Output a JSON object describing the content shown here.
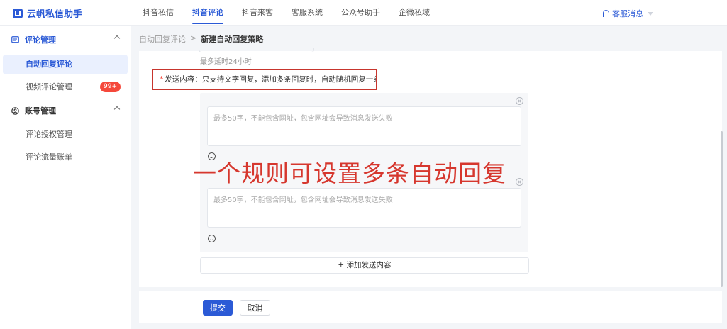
{
  "app": {
    "logo_text": "云帆私信助手"
  },
  "topnav": {
    "items": [
      {
        "label": "抖音私信"
      },
      {
        "label": "抖音评论"
      },
      {
        "label": "抖音来客"
      },
      {
        "label": "客服系统"
      },
      {
        "label": "公众号助手"
      },
      {
        "label": "企微私域"
      }
    ],
    "active_index": 1,
    "notice_label": "客服消息"
  },
  "sidebar": {
    "group1": {
      "label": "评论管理"
    },
    "item_auto_reply": {
      "label": "自动回复评论"
    },
    "item_video_comments": {
      "label": "视频评论管理",
      "badge": "99+"
    },
    "group2": {
      "label": "账号管理"
    },
    "item_auth": {
      "label": "评论授权管理"
    },
    "item_flow": {
      "label": "评论流量账单"
    }
  },
  "breadcrumb": {
    "parent": "自动回复评论",
    "separator": ">",
    "current": "新建自动回复策略"
  },
  "form": {
    "delay_hint": "最多延时24小时",
    "send_content_label": "发送内容：只支持文字回复，添加多条回复时，自动随机回复一条",
    "reply_placeholder": "最多50字，不能包含网址，包含网址会导致消息发送失败",
    "add_button": "+ 添加发送内容",
    "submit": "提交",
    "cancel": "取消"
  },
  "overlay": {
    "text": "一个规则可设置多条自动回复"
  },
  "colors": {
    "accent": "#2b5ad6",
    "highlight": "#c7352d",
    "badge": "#f5483b"
  }
}
